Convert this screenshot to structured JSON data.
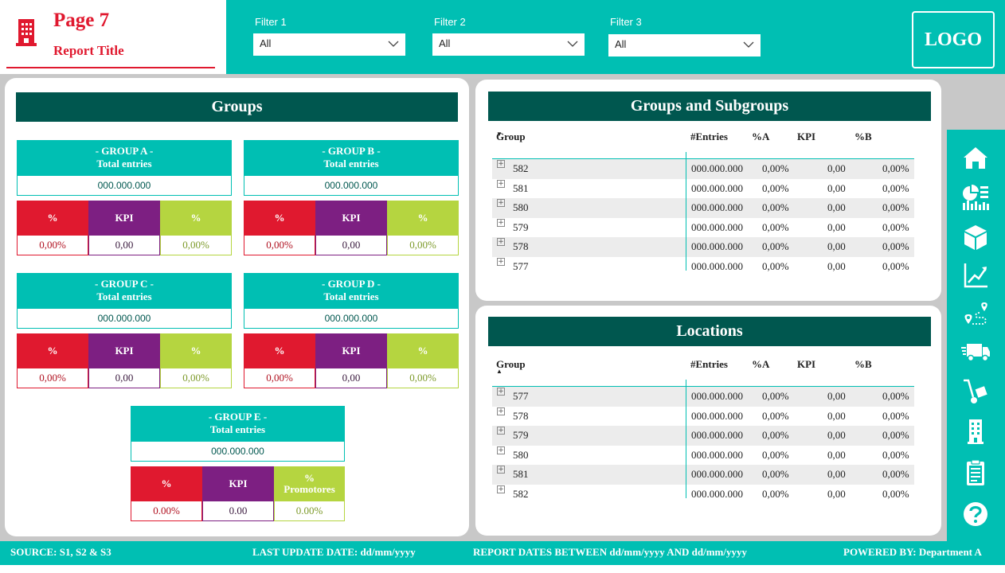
{
  "header": {
    "page": "Page 7",
    "report_title": "Report Title",
    "logo": "LOGO",
    "building_icon": "building-icon"
  },
  "filters": [
    {
      "label": "Filter 1",
      "value": "All"
    },
    {
      "label": "Filter 2",
      "value": "All"
    },
    {
      "label": "Filter 3",
      "value": "All"
    }
  ],
  "groups": {
    "title": "Groups",
    "cards": [
      {
        "name": "- GROUP A -",
        "subtitle": "Total entries",
        "total": "000.000.000",
        "h1": "%",
        "h2": "KPI",
        "h3": "%",
        "v1": "0,00%",
        "v2": "0,00",
        "v3": "0,00%"
      },
      {
        "name": "- GROUP B -",
        "subtitle": "Total entries",
        "total": "000.000.000",
        "h1": "%",
        "h2": "KPI",
        "h3": "%",
        "v1": "0,00%",
        "v2": "0,00",
        "v3": "0,00%"
      },
      {
        "name": "- GROUP C -",
        "subtitle": "Total entries",
        "total": "000.000.000",
        "h1": "%",
        "h2": "KPI",
        "h3": "%",
        "v1": "0,00%",
        "v2": "0,00",
        "v3": "0,00%"
      },
      {
        "name": "- GROUP D -",
        "subtitle": "Total entries",
        "total": "000.000.000",
        "h1": "%",
        "h2": "KPI",
        "h3": "%",
        "v1": "0,00%",
        "v2": "0,00",
        "v3": "0,00%"
      },
      {
        "name": "- GROUP E -",
        "subtitle": "Total entries",
        "total": "000.000.000",
        "h1": "%",
        "h2": "KPI",
        "h3a": "%",
        "h3b": "Promotores",
        "v1": "0.00%",
        "v2": "0.00",
        "v3": "0.00%"
      }
    ]
  },
  "groups_subgroups": {
    "title": "Groups and Subgroups",
    "columns": [
      "Group",
      "#Entries",
      "%A",
      "KPI",
      "%B"
    ],
    "sort": "descending",
    "rows": [
      {
        "group": "582",
        "entries": "000.000.000",
        "a": "0,00%",
        "kpi": "0,00",
        "b": "0,00%"
      },
      {
        "group": "581",
        "entries": "000.000.000",
        "a": "0,00%",
        "kpi": "0,00",
        "b": "0,00%"
      },
      {
        "group": "580",
        "entries": "000.000.000",
        "a": "0,00%",
        "kpi": "0,00",
        "b": "0,00%"
      },
      {
        "group": "579",
        "entries": "000.000.000",
        "a": "0,00%",
        "kpi": "0,00",
        "b": "0,00%"
      },
      {
        "group": "578",
        "entries": "000.000.000",
        "a": "0,00%",
        "kpi": "0,00",
        "b": "0,00%"
      },
      {
        "group": "577",
        "entries": "000.000.000",
        "a": "0,00%",
        "kpi": "0,00",
        "b": "0,00%"
      }
    ]
  },
  "locations": {
    "title": "Locations",
    "columns": [
      "Group",
      "#Entries",
      "%A",
      "KPI",
      "%B"
    ],
    "sort": "ascending",
    "rows": [
      {
        "group": "577",
        "entries": "000.000.000",
        "a": "0,00%",
        "kpi": "0,00",
        "b": "0,00%"
      },
      {
        "group": "578",
        "entries": "000.000.000",
        "a": "0,00%",
        "kpi": "0,00",
        "b": "0,00%"
      },
      {
        "group": "579",
        "entries": "000.000.000",
        "a": "0,00%",
        "kpi": "0,00",
        "b": "0,00%"
      },
      {
        "group": "580",
        "entries": "000.000.000",
        "a": "0,00%",
        "kpi": "0,00",
        "b": "0,00%"
      },
      {
        "group": "581",
        "entries": "000.000.000",
        "a": "0,00%",
        "kpi": "0,00",
        "b": "0,00%"
      },
      {
        "group": "582",
        "entries": "000.000.000",
        "a": "0,00%",
        "kpi": "0,00",
        "b": "0,00%"
      }
    ]
  },
  "nav": [
    "home-icon",
    "dashboard-icon",
    "package-icon",
    "trend-chart-icon",
    "route-icon",
    "truck-icon",
    "hand-truck-icon",
    "building-icon",
    "clipboard-icon",
    "help-icon"
  ],
  "footer": {
    "source": "SOURCE: S1, S2 & S3",
    "last_update": "LAST UPDATE DATE:  dd/mm/yyyy",
    "report_dates": "REPORT DATES BETWEEN dd/mm/yyyy AND dd/mm/yyyy",
    "powered_by": "POWERED BY: Department A"
  },
  "colors": {
    "teal": "#00bfb3",
    "dark_teal": "#00574f",
    "red": "#e0192f",
    "purple": "#7d1f82",
    "lime": "#b5d540"
  }
}
